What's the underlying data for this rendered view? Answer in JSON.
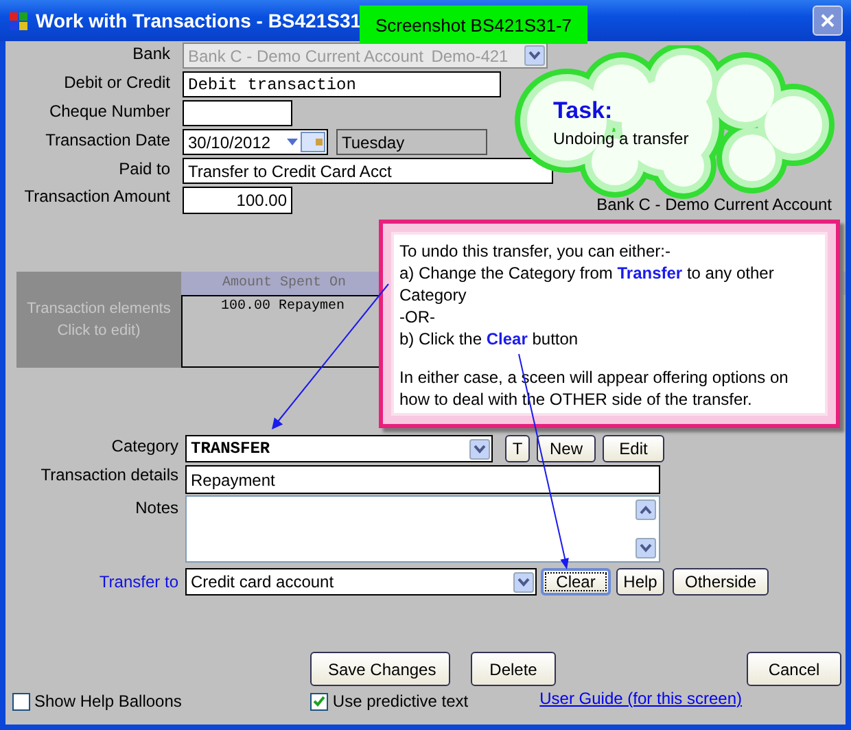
{
  "window": {
    "title": "Work with Transactions - BS421S31",
    "badge": "Screenshot BS421S31-7"
  },
  "form": {
    "bank": {
      "label": "Bank",
      "value": "Bank C - Demo Current Account",
      "code": "Demo-421",
      "disabled": true
    },
    "debit_credit": {
      "label": "Debit or Credit",
      "value": "Debit transaction"
    },
    "cheque_number": {
      "label": "Cheque Number"
    },
    "transaction_date": {
      "label": "Transaction Date",
      "value": "30/10/2012",
      "weekday": "Tuesday"
    },
    "paid_to": {
      "label": "Paid to",
      "value": "Transfer to Credit Card Acct"
    },
    "transaction_amount": {
      "label": "Transaction Amount",
      "value": "100.00"
    },
    "account_note": "Bank C - Demo Current Account",
    "elements": {
      "label_lines": [
        "Transaction elements",
        "Click to edit)"
      ],
      "columns": [
        "Amount Spent On"
      ],
      "rows": [
        "100.00 Repaymen"
      ]
    },
    "category": {
      "label": "Category",
      "value": "TRANSFER",
      "buttons": [
        "T",
        "New",
        "Edit"
      ]
    },
    "transaction_details": {
      "label": "Transaction details",
      "value": "Repayment"
    },
    "notes": {
      "label": "Notes"
    },
    "transfer_to": {
      "label": "Transfer to",
      "value": "Credit card account",
      "buttons": [
        {
          "label": "Clear",
          "focused": true
        },
        {
          "label": "Help",
          "focused": false
        },
        {
          "label": "Otherside",
          "focused": false
        }
      ]
    }
  },
  "actions": [
    "Save Changes",
    "Delete",
    "Cancel"
  ],
  "options": [
    {
      "label": "Show Help Balloons",
      "checked": false
    },
    {
      "label": "Use predictive text",
      "checked": true
    }
  ],
  "link": "User Guide (for this screen)",
  "task_cloud": {
    "title": "Task:",
    "text": "Undoing a transfer"
  },
  "callout": {
    "paragraphs": [
      "To undo this transfer, you can either:-",
      "a) Change the Category from **Transfer** to any other Category",
      "-OR-",
      "b) Click the **Clear** button",
      "In either case, a sceen will appear offering options on how to deal with the OTHER side of the transfer."
    ]
  }
}
